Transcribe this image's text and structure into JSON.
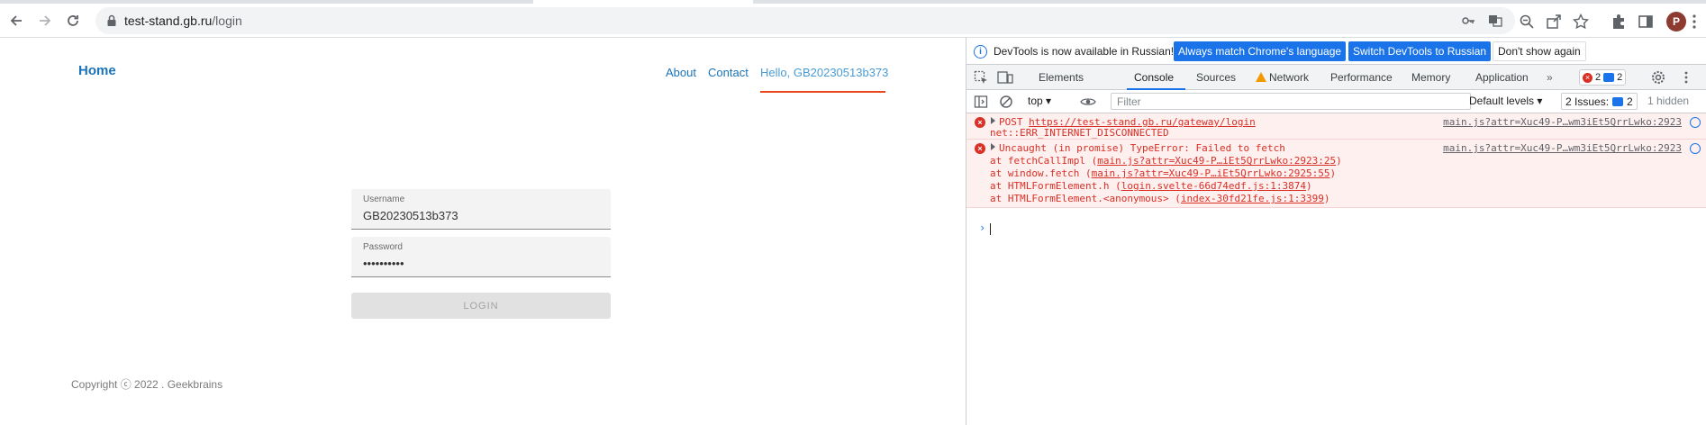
{
  "browser": {
    "url_host": "test-stand.gb.ru",
    "url_path": "/login",
    "avatar_letter": "P"
  },
  "site": {
    "brand": "Home",
    "nav": [
      "About",
      "Contact",
      "Hello, GB20230513b373"
    ],
    "username_label": "Username",
    "username_value": "GB20230513b373",
    "password_label": "Password",
    "password_value": "••••••••••",
    "login_button": "LOGIN",
    "copyright": "Copyright ⓒ 2022 . Geekbrains",
    "accent_color": "#1a73b8",
    "underline_color": "#e8481b"
  },
  "devtools": {
    "info_message": "DevTools is now available in Russian!",
    "btn_match": "Always match Chrome's language",
    "btn_switch": "Switch DevTools to Russian",
    "btn_dismiss": "Don't show again",
    "tabs": [
      "Elements",
      "Console",
      "Sources",
      "Network",
      "Performance",
      "Memory",
      "Application"
    ],
    "active_tab": "Console",
    "error_count": "2",
    "message_count": "2",
    "context": "top",
    "filter_placeholder": "Filter",
    "levels": "Default levels",
    "issues_label": "2 Issues:",
    "issues_count": "2",
    "hidden": "1 hidden",
    "errors": [
      {
        "lines": [
          "POST ",
          "https://test-stand.gb.ru/gateway/login"
        ],
        "line2": "net::ERR_INTERNET_DISCONNECTED",
        "source": "main.js?attr=Xuc49-P…wm3iEt5QrrLwko:2923"
      },
      {
        "head": "Uncaught (in promise) TypeError: Failed to fetch",
        "stack": [
          {
            "fn": "    at fetchCallImpl (",
            "link": "main.js?attr=Xuc49-P…iEt5QrrLwko:2923:25",
            "end": ")"
          },
          {
            "fn": "    at window.fetch (",
            "link": "main.js?attr=Xuc49-P…iEt5QrrLwko:2925:55",
            "end": ")"
          },
          {
            "fn": "    at HTMLFormElement.h (",
            "link": "login.svelte-66d74edf.js:1:3874",
            "end": ")"
          },
          {
            "fn": "    at HTMLFormElement.<anonymous> (",
            "link": "index-30fd21fe.js:1:3399",
            "end": ")"
          }
        ],
        "source": "main.js?attr=Xuc49-P…wm3iEt5QrrLwko:2923"
      }
    ],
    "prompt": "›"
  }
}
